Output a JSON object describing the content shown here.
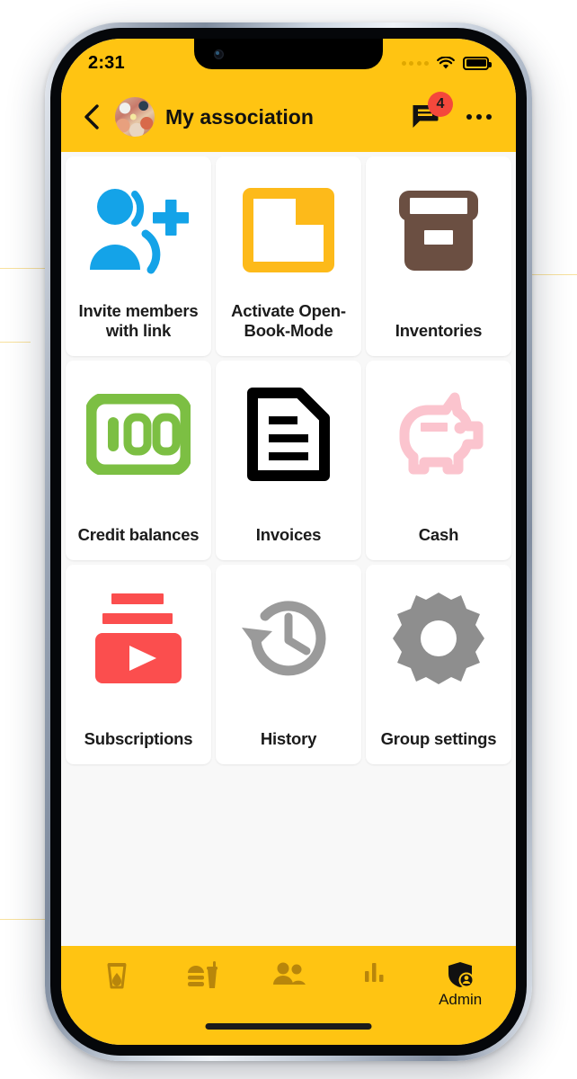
{
  "status_bar": {
    "time": "2:31",
    "signal_icon": "signal-dots-icon",
    "wifi_icon": "wifi-icon",
    "battery_icon": "battery-full-icon"
  },
  "app_bar": {
    "back_icon": "back-chevron-icon",
    "avatar_icon": "group-avatar-photo",
    "title": "My association",
    "chat_icon": "chat-bubble-icon",
    "chat_badge": "4",
    "overflow_icon": "more-horizontal-icon",
    "background_color": "#FFC412",
    "badge_color": "#F4483C"
  },
  "grid": {
    "tiles": [
      {
        "label": "Invite members with link",
        "icon": "person-add-icon",
        "color": "#14A3E8"
      },
      {
        "label": "Activate Open-Book-Mode",
        "icon": "folder-icon",
        "color": "#FDBA1A"
      },
      {
        "label": "Inventories",
        "icon": "archive-box-icon",
        "color": "#6B4F42"
      },
      {
        "label": "Credit balances",
        "icon": "banknote-100-icon",
        "color": "#7CBF43"
      },
      {
        "label": "Invoices",
        "icon": "document-lines-icon",
        "color": "#000000"
      },
      {
        "label": "Cash",
        "icon": "piggy-bank-icon",
        "color": "#FBC4CE"
      },
      {
        "label": "Subscriptions",
        "icon": "subscriptions-play-icon",
        "color": "#FB4E4E"
      },
      {
        "label": "History",
        "icon": "history-clock-icon",
        "color": "#9A9A9A"
      },
      {
        "label": "Group settings",
        "icon": "gear-icon",
        "color": "#8E8E8E"
      }
    ]
  },
  "bottom_nav": {
    "items": [
      {
        "label": "",
        "icon": "drink-glass-icon",
        "active": false
      },
      {
        "label": "",
        "icon": "fast-food-icon",
        "active": false
      },
      {
        "label": "",
        "icon": "people-group-icon",
        "active": false
      },
      {
        "label": "",
        "icon": "bar-chart-icon",
        "active": false
      },
      {
        "label": "Admin",
        "icon": "admin-shield-icon",
        "active": true
      }
    ],
    "inactive_color": "#B8860B",
    "active_color": "#111111"
  }
}
